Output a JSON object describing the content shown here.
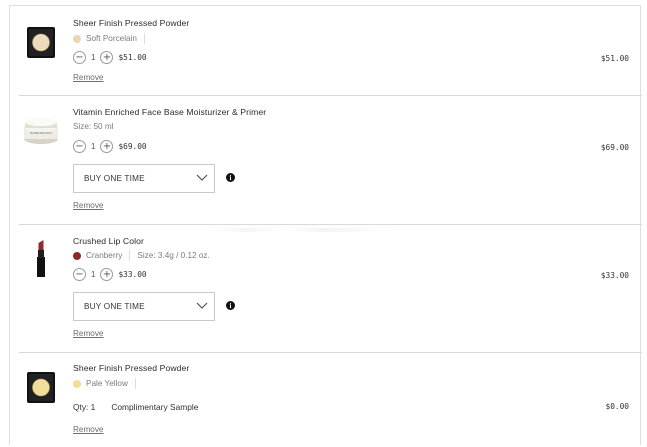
{
  "items": [
    {
      "name": "Sheer Finish Pressed Powder",
      "shade": "Soft Porcelain",
      "shade_color": "#e9d6b3",
      "qty": "1",
      "unit_price": "$51.00",
      "total": "$51.00",
      "remove": "Remove",
      "image": "compact-powder"
    },
    {
      "name": "Vitamin Enriched Face Base Moisturizer & Primer",
      "size": "Size: 50 ml",
      "qty": "1",
      "unit_price": "$69.00",
      "total": "$69.00",
      "select_value": "BUY ONE TIME",
      "remove": "Remove",
      "image": "cream-jar"
    },
    {
      "name": "Crushed Lip Color",
      "shade": "Cranberry",
      "shade_color": "#8a2b26",
      "size": "Size: 3.4g / 0.12 oz.",
      "qty": "1",
      "unit_price": "$33.00",
      "total": "$33.00",
      "select_value": "BUY ONE TIME",
      "remove": "Remove",
      "image": "lipstick"
    },
    {
      "name": "Sheer Finish Pressed Powder",
      "shade": "Pale Yellow",
      "shade_color": "#f1dc98",
      "qty_label": "Qty: 1",
      "sample_label": "Complimentary Sample",
      "total": "$0.00",
      "remove": "Remove",
      "image": "compact-powder"
    }
  ],
  "icons": {
    "minus": "−",
    "plus": "+",
    "info": "i"
  }
}
